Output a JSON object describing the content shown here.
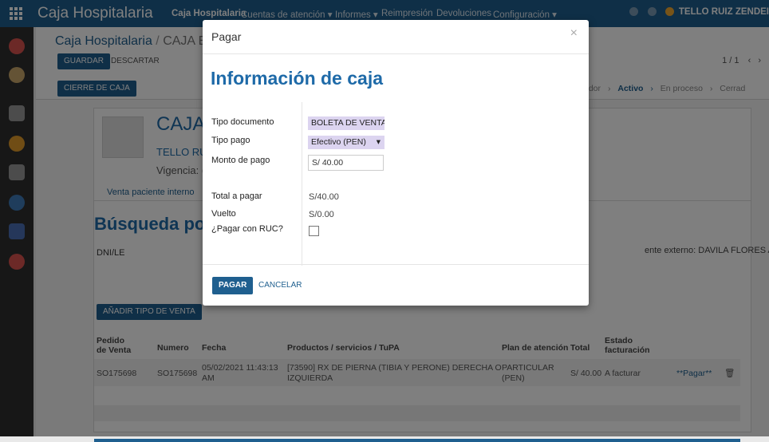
{
  "app": {
    "brand": "Caja Hospitalaria",
    "menu": [
      "Caja Hospitalaria",
      "Cuentas de atención ▾",
      "Informes ▾",
      "Reimpresión",
      "Devoluciones",
      "Configuración ▾"
    ],
    "user": "TELLO RUIZ ZENDEI"
  },
  "control_panel": {
    "breadcrumb_root": "Caja Hospitalaria",
    "breadcrumb_sep": "/",
    "breadcrumb_current": "CAJA EMI",
    "save_label": "GUARDAR",
    "discard_label": "DESCARTAR",
    "pager": "1 / 1",
    "cierre_label": "CIERRE DE CAJA",
    "status": [
      "rrador",
      "Activo",
      "En proceso",
      "Cerrad"
    ]
  },
  "form": {
    "title_fragment": "CAJA",
    "user_fragment": "TELLO RU",
    "vigencia_fragment": "Vigencia: (",
    "tab_label": "Venta paciente interno",
    "search_heading": "Búsqueda por",
    "dni_label": "DNI/LE",
    "patient_info": "ente externo: DAVILA FLORES ANGEL",
    "add_sale_label": "AÑADIR TIPO DE VENTA"
  },
  "table": {
    "headers": [
      "Pedido de Venta",
      "Numero",
      "Fecha",
      "Productos / servicios / TuPA",
      "Plan de atención",
      "Total",
      "Estado facturación"
    ],
    "rows": [
      {
        "pedido": "SO175698",
        "numero": "SO175698",
        "fecha_line1": "05/02/2021 11:43:13",
        "fecha_line2": "AM",
        "producto_line1": "[73590] RX DE PIERNA (TIBIA Y PERONE) DERECHA O",
        "producto_line2": "IZQUIERDA",
        "plan_line1": "PARTICULAR",
        "plan_line2": "(PEN)",
        "total": "S/ 40.00",
        "estado": "A facturar",
        "pagar": "**Pagar**"
      }
    ]
  },
  "modal": {
    "header_title": "Pagar",
    "close_glyph": "×",
    "heading": "Información de caja",
    "tipo_documento_label": "Tipo documento",
    "tipo_documento_value": "BOLETA DE VENTA ▾",
    "tipo_pago_label": "Tipo pago",
    "tipo_pago_value": "Efectivo (PEN)",
    "monto_label": "Monto de pago",
    "monto_value": "S/ 40.00",
    "total_label": "Total a pagar",
    "total_value": "S/40.00",
    "vuelto_label": "Vuelto",
    "vuelto_value": "S/0.00",
    "ruc_label": "¿Pagar con RUC?",
    "ruc_checked": false,
    "pay_label": "PAGAR",
    "cancel_label": "CANCELAR"
  },
  "colors": {
    "primary": "#1f5f8f",
    "heading_blue": "#1e6aa8",
    "select_bg": "#dcd4f0"
  }
}
